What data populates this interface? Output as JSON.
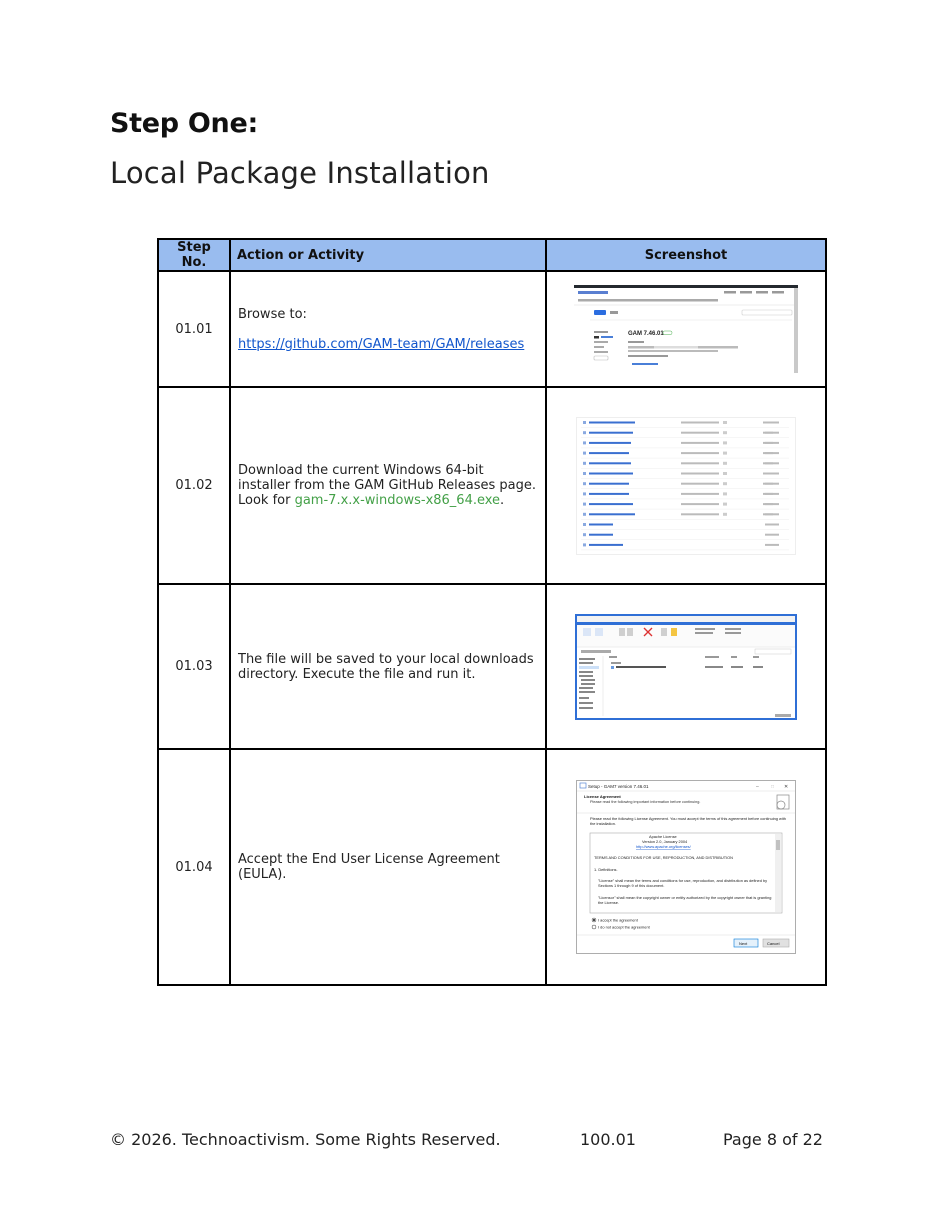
{
  "heading": {
    "step": "Step One:",
    "subtitle": "Local Package Installation"
  },
  "table": {
    "headers": [
      "Step No.",
      "Action or Activity",
      "Screenshot"
    ],
    "rows": [
      {
        "num": "01.01",
        "text1": "Browse to:",
        "link": "https://github.com/GAM-team/GAM/releases"
      },
      {
        "num": "01.02",
        "text1": "Download the current Windows 64-bit installer from the GAM GitHub Releases page. Look for ",
        "highlight": "gam-7.x.x-windows-x86_64.exe",
        "text2": "."
      },
      {
        "num": "01.03",
        "text1": "The file will be saved to your local downloads directory. Execute the file and run it."
      },
      {
        "num": "01.04",
        "text1": "Accept the End User License Agreement (EULA)."
      }
    ]
  },
  "shots": {
    "github": {
      "title": "GAM 7.46.01"
    },
    "setup": {
      "title": "Setup - GAM7 version 7.46.01",
      "section": "License Agreement",
      "section_sub": "Please read the following important information before continuing.",
      "instructions": "Please read the following License Agreement. You must accept the terms of this agreement before continuing with the installation.",
      "license_lines": [
        "Apache License",
        "Version 2.0, January 2004",
        "http://www.apache.org/licenses/"
      ],
      "terms": "TERMS AND CONDITIONS FOR USE, REPRODUCTION, AND DISTRIBUTION",
      "def_heading": "1. Definitions.",
      "def1": "\"License\" shall mean the terms and conditions for use, reproduction, and distribution as defined by Sections 1 through 9 of this document.",
      "def2": "\"Licensor\" shall mean the copyright owner or entity authorized by the copyright owner that is granting the License.",
      "accept": "I accept the agreement",
      "decline": "I do not accept the agreement",
      "next": "Next",
      "cancel": "Cancel"
    }
  },
  "footer": {
    "copyright": "© 2026. Technoactivism. Some Rights Reserved.",
    "version": "100.01",
    "page": "Page 8 of 22"
  }
}
